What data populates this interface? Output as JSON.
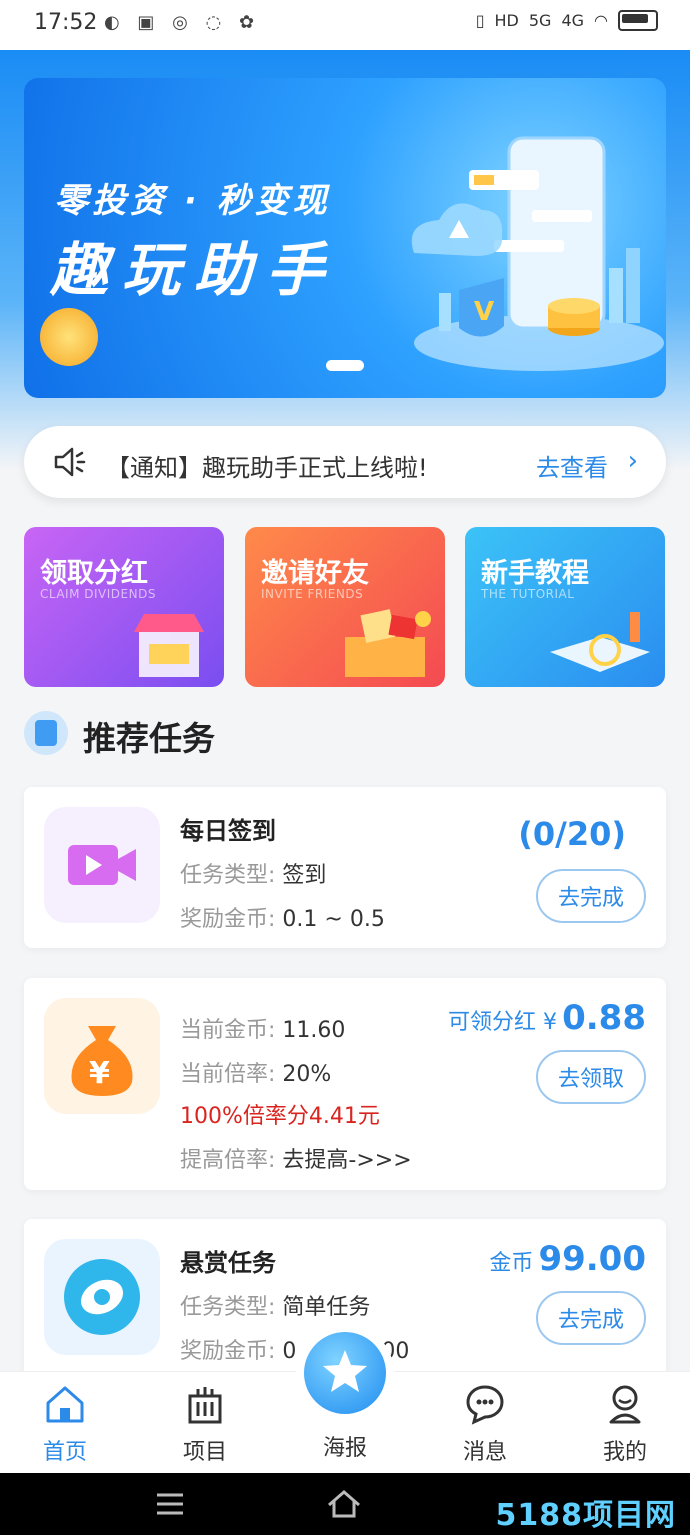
{
  "status_bar": {
    "time": "17:52",
    "hd_label": "HD",
    "net1": "5G",
    "net2": "4G"
  },
  "banner": {
    "subtitle": "零投资 · 秒变现",
    "title": "趣玩助手"
  },
  "notice": {
    "text": "【通知】趣玩助手正式上线啦!",
    "link": "去查看"
  },
  "features": [
    {
      "title": "领取分红",
      "subtitle": "CLAIM DIVIDENDS"
    },
    {
      "title": "邀请好友",
      "subtitle": "INVITE FRIENDS"
    },
    {
      "title": "新手教程",
      "subtitle": "THE TUTORIAL"
    }
  ],
  "section": {
    "title": "推荐任务"
  },
  "tasks": {
    "checkin": {
      "title": "每日签到",
      "type_label": "任务类型:",
      "type_value": "签到",
      "reward_label": "奖励金币:",
      "reward_value": "0.1 ~ 0.5",
      "progress": "(0/20)",
      "button": "去完成"
    },
    "dividend": {
      "coins_label": "当前金币:",
      "coins_value": "11.60",
      "rate_label": "当前倍率:",
      "rate_value": "20%",
      "highlight": "100%倍率分4.41元",
      "raise_label": "提高倍率:",
      "raise_value": "去提高->>>",
      "claim_label": "可领分红 ¥",
      "claim_amount": "0.88",
      "button": "去领取",
      "icon_glyph": "¥"
    },
    "bounty": {
      "title": "悬赏任务",
      "type_label": "任务类型:",
      "type_value": "简单任务",
      "reward_label": "奖励金币:",
      "reward_value_start": "0",
      "reward_value_end": "00",
      "coin_label": "金币",
      "coin_amount": "99.00",
      "button": "去完成"
    }
  },
  "tabbar": {
    "home": "首页",
    "projects": "项目",
    "poster": "海报",
    "messages": "消息",
    "mine": "我的"
  },
  "watermark": "5188项目网",
  "colors": {
    "accent": "#2c8ae8",
    "highlight_red": "#d9241f",
    "orange": "#ff8a1f",
    "purple": "#d86cf0"
  }
}
